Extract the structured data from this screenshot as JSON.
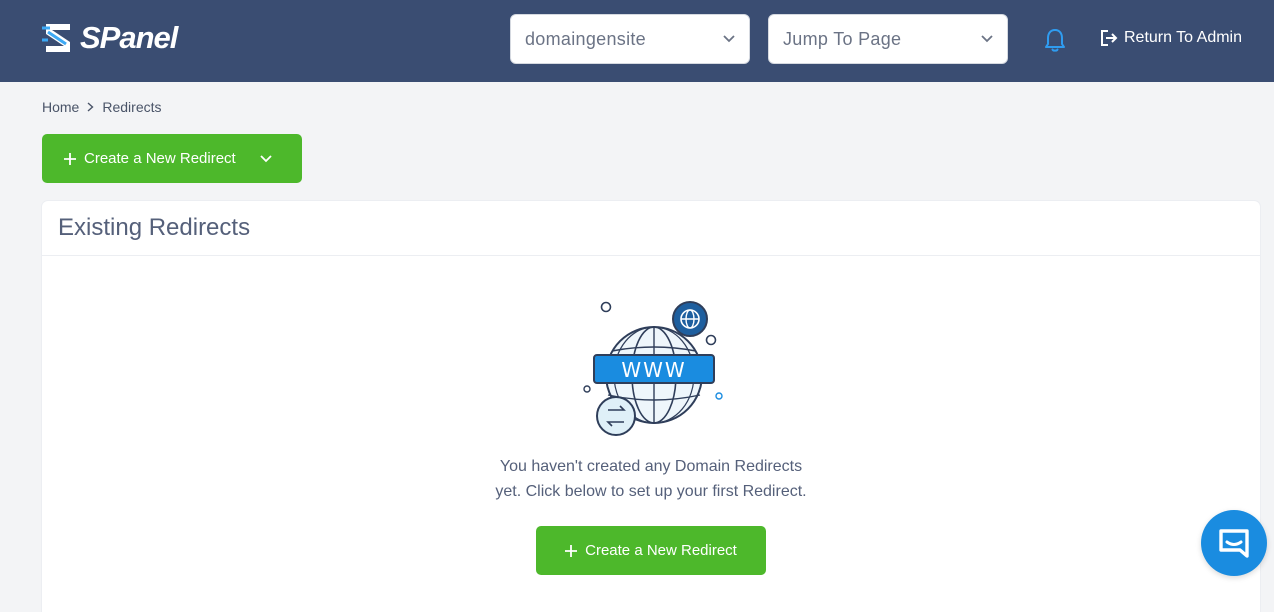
{
  "header": {
    "logo_text": "SPanel",
    "domain_select": {
      "value": "domaingensite"
    },
    "jump_select": {
      "value": "Jump To Page"
    },
    "return_label": "Return To Admin"
  },
  "breadcrumb": {
    "home": "Home",
    "current": "Redirects"
  },
  "actions": {
    "create_label": "Create a New Redirect"
  },
  "card": {
    "title": "Existing Redirects",
    "illustration_label": "WWW",
    "empty_line1": "You haven't created any Domain Redirects",
    "empty_line2": "yet. Click below to set up your first Redirect.",
    "create_label": "Create a New Redirect"
  },
  "colors": {
    "topbar": "#3a4d72",
    "accent_green": "#4db82b",
    "accent_blue": "#1a8ce0"
  },
  "icons": [
    "spanel-logo-icon",
    "chevron-down-icon",
    "bell-icon",
    "logout-icon",
    "chevron-right-icon",
    "plus-icon",
    "globe-www-icon",
    "chat-icon"
  ]
}
